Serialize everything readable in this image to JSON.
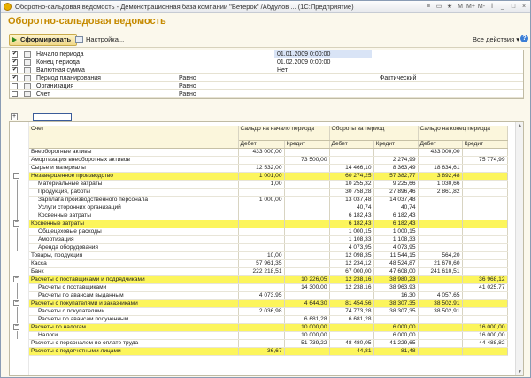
{
  "window": {
    "title": "Оборотно-сальдовая ведомость - Демонстрационная база компании \"Ветерок\" /Абдулов ... (1С:Предприятие)",
    "ctrl_icons": [
      "≡",
      "▭",
      "★",
      "M",
      "M+",
      "M-",
      "i",
      "_",
      "□",
      "×"
    ]
  },
  "page_title": "Оборотно-сальдовая ведомость",
  "toolbar": {
    "generate_label": "Сформировать",
    "settings_label": "Настройка...",
    "all_actions_label": "Все действия ▾",
    "help_label": "?"
  },
  "settings": [
    {
      "checked": true,
      "label": "Начало периода",
      "value": "01.01.2009 0:00:00",
      "selected": true
    },
    {
      "checked": true,
      "label": "Конец периода",
      "value": "01.02.2009 0:00:00"
    },
    {
      "checked": true,
      "label": "Валютная сумма",
      "value": "Нет"
    },
    {
      "checked": true,
      "label": "Период планирования",
      "mode": "Равно",
      "fact": "Фактический"
    },
    {
      "checked": false,
      "label": "Организация",
      "mode": "Равно"
    },
    {
      "checked": false,
      "label": "Счет",
      "mode": "Равно"
    }
  ],
  "report": {
    "headers": {
      "account": "Счет",
      "opening": "Сальдо на начало периода",
      "turnover": "Обороты за период",
      "closing": "Сальдо на конец периода",
      "debit": "Дебет",
      "credit": "Кредит"
    },
    "rows": [
      {
        "name": "Внеоборотные активы",
        "level": 0,
        "hl": false,
        "v": [
          "433 000,00",
          "",
          "",
          "",
          "433 000,00",
          ""
        ]
      },
      {
        "name": "Амортизация внеоборотных активов",
        "level": 0,
        "hl": false,
        "v": [
          "",
          "73 500,00",
          "",
          "2 274,99",
          "",
          "75 774,99"
        ]
      },
      {
        "name": "Сырье и материалы",
        "level": 0,
        "hl": false,
        "v": [
          "12 532,00",
          "",
          "14 466,10",
          "8 363,49",
          "18 634,61",
          ""
        ]
      },
      {
        "name": "Незавершенное производство",
        "level": 0,
        "hl": true,
        "v": [
          "1 001,00",
          "",
          "60 274,25",
          "57 382,77",
          "3 892,48",
          ""
        ]
      },
      {
        "name": "Материальные затраты",
        "level": 1,
        "hl": false,
        "v": [
          "1,00",
          "",
          "10 255,32",
          "9 225,66",
          "1 030,66",
          ""
        ]
      },
      {
        "name": "Продукция, работы",
        "level": 1,
        "hl": false,
        "v": [
          "",
          "",
          "30 758,28",
          "27 896,46",
          "2 861,82",
          ""
        ]
      },
      {
        "name": "Зарплата производственного персонала",
        "level": 1,
        "hl": false,
        "v": [
          "1 000,00",
          "",
          "13 037,48",
          "14 037,48",
          "",
          ""
        ]
      },
      {
        "name": "Услуги сторонних организаций",
        "level": 1,
        "hl": false,
        "v": [
          "",
          "",
          "40,74",
          "40,74",
          "",
          ""
        ]
      },
      {
        "name": "Косвенные затраты",
        "level": 1,
        "hl": false,
        "v": [
          "",
          "",
          "6 182,43",
          "6 182,43",
          "",
          ""
        ]
      },
      {
        "name": "Косвенные затраты",
        "level": 0,
        "hl": true,
        "v": [
          "",
          "",
          "6 182,43",
          "6 182,43",
          "",
          ""
        ]
      },
      {
        "name": "Общецеховые расходы",
        "level": 1,
        "hl": false,
        "v": [
          "",
          "",
          "1 000,15",
          "1 000,15",
          "",
          ""
        ]
      },
      {
        "name": "Амортизация",
        "level": 1,
        "hl": false,
        "v": [
          "",
          "",
          "1 108,33",
          "1 108,33",
          "",
          ""
        ]
      },
      {
        "name": "Аренда оборудования",
        "level": 1,
        "hl": false,
        "v": [
          "",
          "",
          "4 073,95",
          "4 073,95",
          "",
          ""
        ]
      },
      {
        "name": "Товары, продукция",
        "level": 0,
        "hl": false,
        "v": [
          "10,00",
          "",
          "12 098,35",
          "11 544,15",
          "564,20",
          ""
        ]
      },
      {
        "name": "Касса",
        "level": 0,
        "hl": false,
        "v": [
          "57 961,35",
          "",
          "12 234,12",
          "48 524,87",
          "21 670,60",
          ""
        ]
      },
      {
        "name": "Банк",
        "level": 0,
        "hl": false,
        "v": [
          "222 218,51",
          "",
          "67 000,00",
          "47 608,00",
          "241 610,51",
          ""
        ]
      },
      {
        "name": "Расчеты с поставщиками и подрядчиками",
        "level": 0,
        "hl": true,
        "v": [
          "",
          "10 226,05",
          "12 238,16",
          "38 980,23",
          "",
          "36 968,12"
        ]
      },
      {
        "name": "Расчеты с поставщиками",
        "level": 1,
        "hl": false,
        "v": [
          "",
          "14 300,00",
          "12 238,16",
          "38 963,93",
          "",
          "41 025,77"
        ]
      },
      {
        "name": "Расчеты по авансам выданным",
        "level": 1,
        "hl": false,
        "v": [
          "4 073,95",
          "",
          "",
          "16,30",
          "4 057,65",
          ""
        ]
      },
      {
        "name": "Расчеты с покупателями и заказчиками",
        "level": 0,
        "hl": true,
        "v": [
          "",
          "4 644,30",
          "81 454,56",
          "38 307,35",
          "38 502,91",
          ""
        ]
      },
      {
        "name": "Расчеты с покупателями",
        "level": 1,
        "hl": false,
        "v": [
          "2 036,98",
          "",
          "74 773,28",
          "38 307,35",
          "38 502,91",
          ""
        ]
      },
      {
        "name": "Расчеты по авансам полученным",
        "level": 1,
        "hl": false,
        "v": [
          "",
          "6 681,28",
          "6 681,28",
          "",
          "",
          ""
        ]
      },
      {
        "name": "Расчеты по налогам",
        "level": 0,
        "hl": true,
        "v": [
          "",
          "10 000,00",
          "",
          "6 000,00",
          "",
          "16 000,00"
        ]
      },
      {
        "name": "Налоги",
        "level": 1,
        "hl": false,
        "v": [
          "",
          "10 000,00",
          "",
          "6 000,00",
          "",
          "16 000,00"
        ]
      },
      {
        "name": "Расчеты с персоналом по оплате труда",
        "level": 0,
        "hl": false,
        "v": [
          "",
          "51 739,22",
          "48 480,05",
          "41 229,65",
          "",
          "44 488,82"
        ]
      },
      {
        "name": "Расчеты с подотчетными лицами",
        "level": 0,
        "hl": true,
        "v": [
          "36,67",
          "",
          "44,81",
          "81,48",
          "",
          ""
        ]
      }
    ]
  }
}
